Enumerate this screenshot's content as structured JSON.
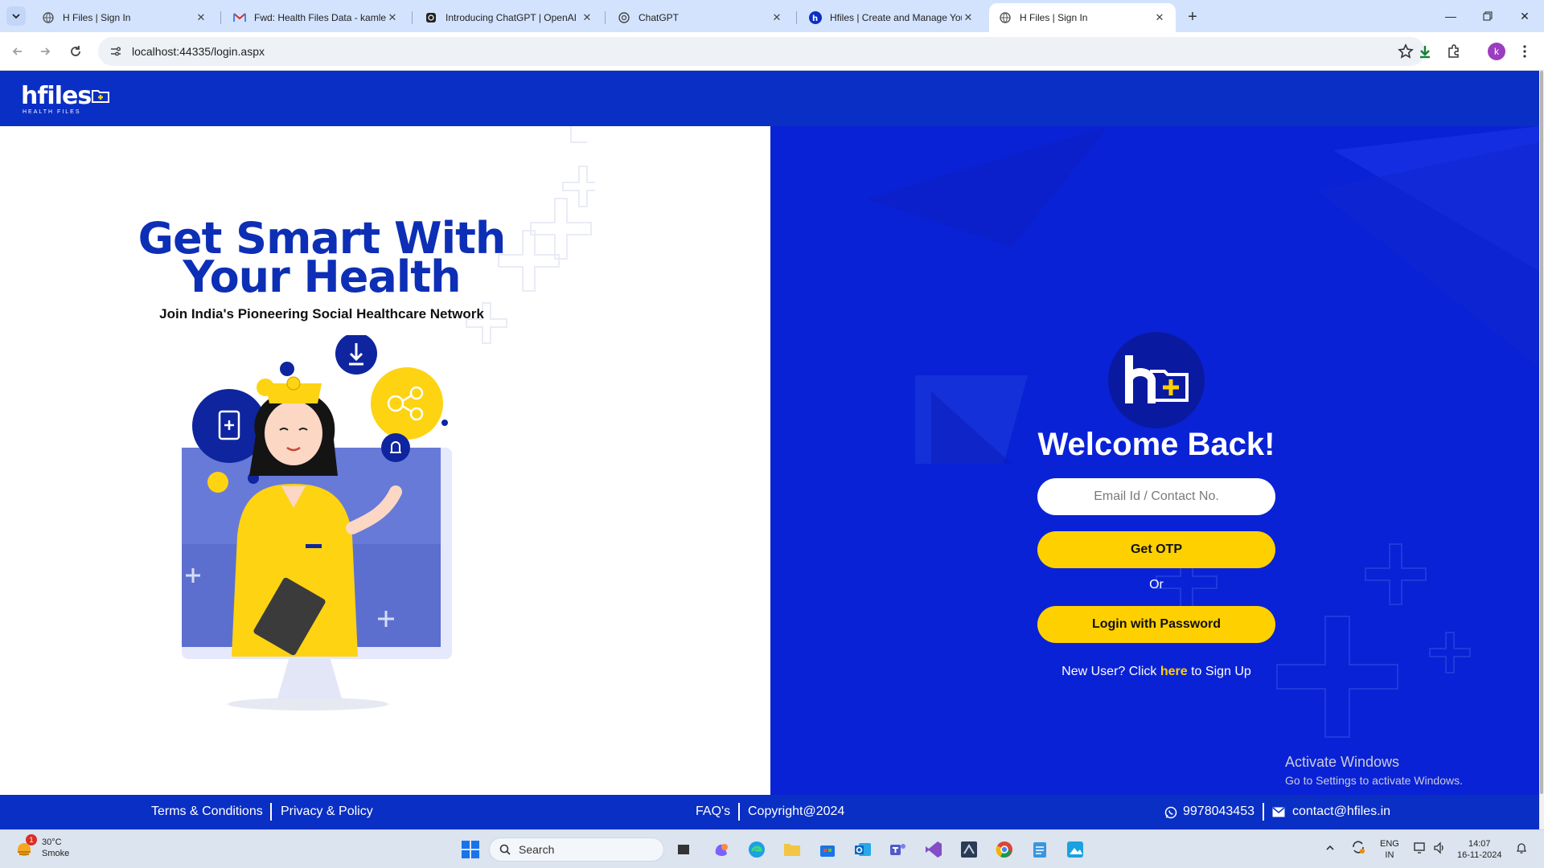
{
  "browser": {
    "tabs": [
      {
        "title": "H Files | Sign In",
        "active": false
      },
      {
        "title": "Fwd: Health Files Data - kamlesh",
        "active": false
      },
      {
        "title": "Introducing ChatGPT | OpenAI",
        "active": false
      },
      {
        "title": "ChatGPT",
        "active": false
      },
      {
        "title": "Hfiles | Create and Manage Your",
        "active": false
      },
      {
        "title": "H Files | Sign In",
        "active": true
      }
    ],
    "url": "localhost:44335/login.aspx",
    "profile_initial": "k"
  },
  "header": {
    "logo_text": "hfiles",
    "logo_sub": "HEALTH FILES"
  },
  "hero": {
    "title_line1": "Get Smart With",
    "title_line2": "Your Health",
    "subtitle": "Join India's Pioneering Social Healthcare Network"
  },
  "login": {
    "welcome": "Welcome Back!",
    "email_placeholder": "Email Id / Contact No.",
    "get_otp_label": "Get OTP",
    "or_label": "Or",
    "password_login_label": "Login with Password",
    "signup_prefix": "New User? Click ",
    "signup_link": "here",
    "signup_suffix": " to Sign Up"
  },
  "watermark": {
    "line1": "Activate Windows",
    "line2": "Go to Settings to activate Windows."
  },
  "footer": {
    "terms": "Terms & Conditions",
    "privacy": "Privacy & Policy",
    "faq": "FAQ's",
    "copyright": "Copyright@2024",
    "phone": "9978043453",
    "email": "contact@hfiles.in"
  },
  "taskbar": {
    "weather_temp": "30°C",
    "weather_desc": "Smoke",
    "weather_badge": "1",
    "search_label": "Search",
    "lang_line1": "ENG",
    "lang_line2": "IN",
    "time": "14:07",
    "date": "16-11-2024"
  },
  "colors": {
    "brand_blue": "#0a2fc4",
    "panel_blue": "#0a22d6",
    "accent_yellow": "#ffd000"
  }
}
